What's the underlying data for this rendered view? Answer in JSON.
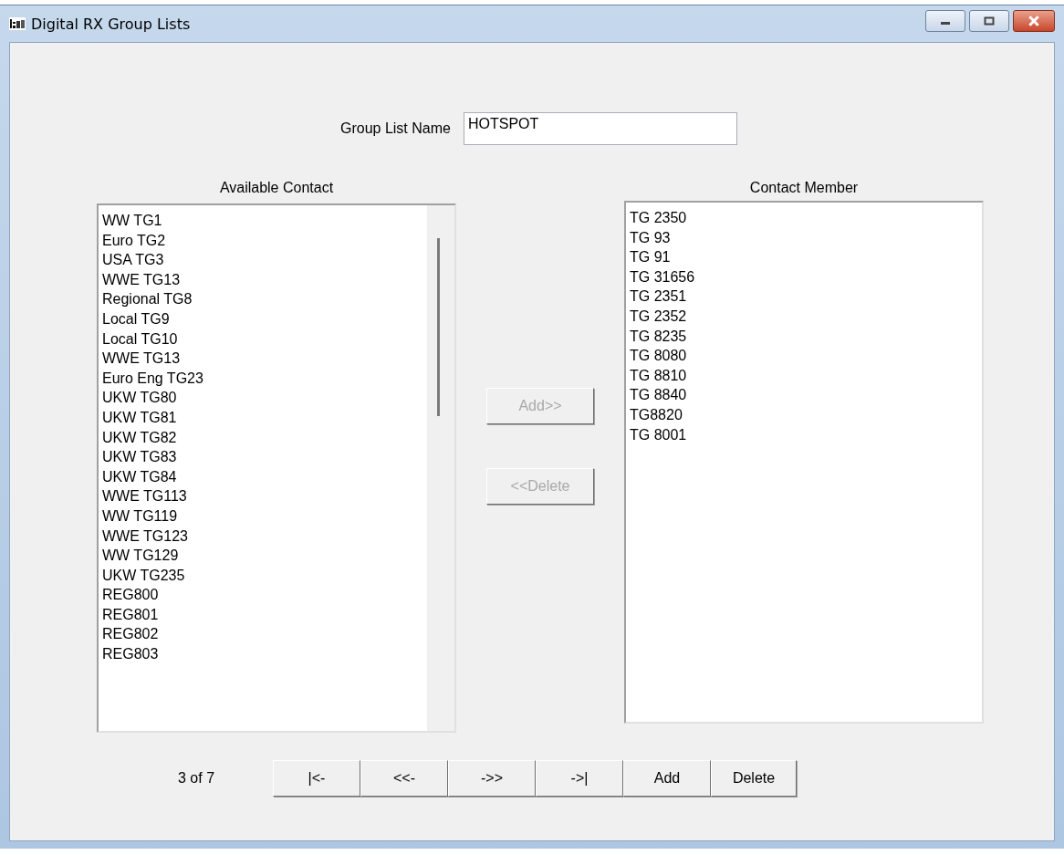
{
  "window": {
    "title": "Digital RX Group Lists"
  },
  "group_list_name": {
    "label": "Group List Name",
    "value": "HOTSPOT"
  },
  "available_contact": {
    "heading": "Available Contact",
    "items": [
      "WW TG1",
      "Euro TG2",
      "USA TG3",
      "WWE TG13",
      "Regional TG8",
      "Local TG9",
      "Local TG10",
      "WWE TG13",
      "Euro Eng TG23",
      "UKW TG80",
      "UKW TG81",
      "UKW TG82",
      "UKW TG83",
      "UKW TG84",
      "WWE TG113",
      "WW TG119",
      "WWE TG123",
      "WW TG129",
      "UKW TG235",
      "REG800",
      "REG801",
      "REG802",
      "REG803"
    ]
  },
  "transfer_buttons": [
    {
      "label": "Add>>",
      "disabled": true
    },
    {
      "label": "<<Delete",
      "disabled": true
    }
  ],
  "contact_member": {
    "heading": "Contact Member",
    "items": [
      "TG 2350",
      "TG 93",
      "TG 91",
      "TG 31656",
      "TG 2351",
      "TG 2352",
      "TG 8235",
      "TG 8080",
      "TG 8810",
      "TG 8840",
      "TG8820",
      "TG 8001"
    ]
  },
  "record_position": "3 of 7",
  "nav_buttons": [
    {
      "label": "|<-"
    },
    {
      "label": "<<-"
    },
    {
      "label": "->>"
    },
    {
      "label": "->|"
    },
    {
      "label": "Add"
    },
    {
      "label": "Delete"
    }
  ]
}
